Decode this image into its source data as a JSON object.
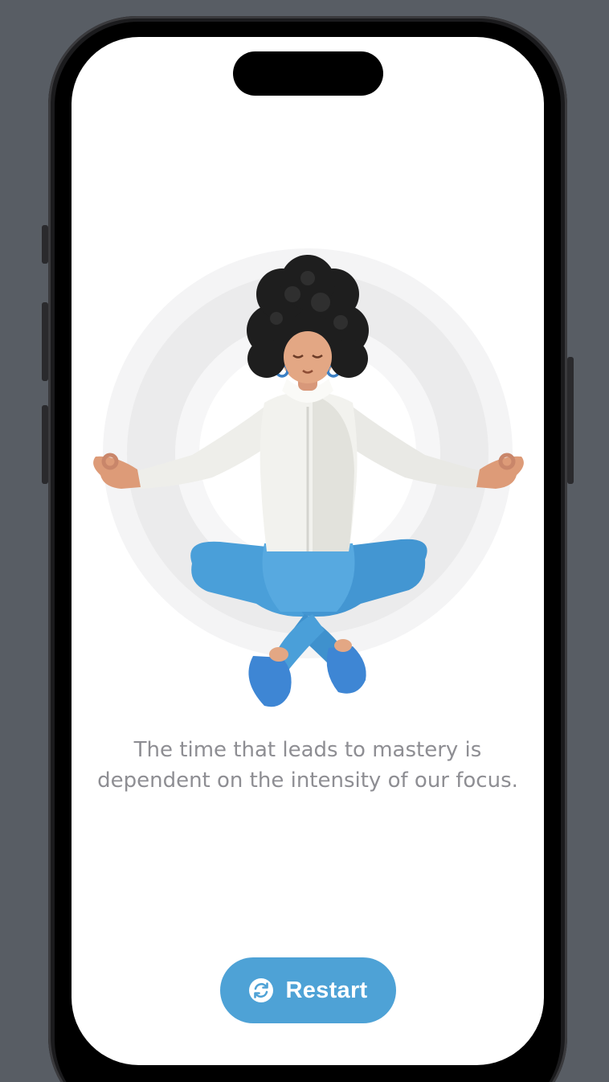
{
  "quote": {
    "line1": "The time that leads to mastery is",
    "line2": "dependent on the intensity of our focus."
  },
  "restart_button": {
    "label": "Restart",
    "icon": "restart-arrows-icon"
  },
  "illustration": {
    "subject": "meditating-woman-illustration"
  },
  "colors": {
    "accent": "#4ea2d6",
    "quote_text": "#8e8e93",
    "screen_background": "#ffffff",
    "device_background": "#585d64"
  }
}
